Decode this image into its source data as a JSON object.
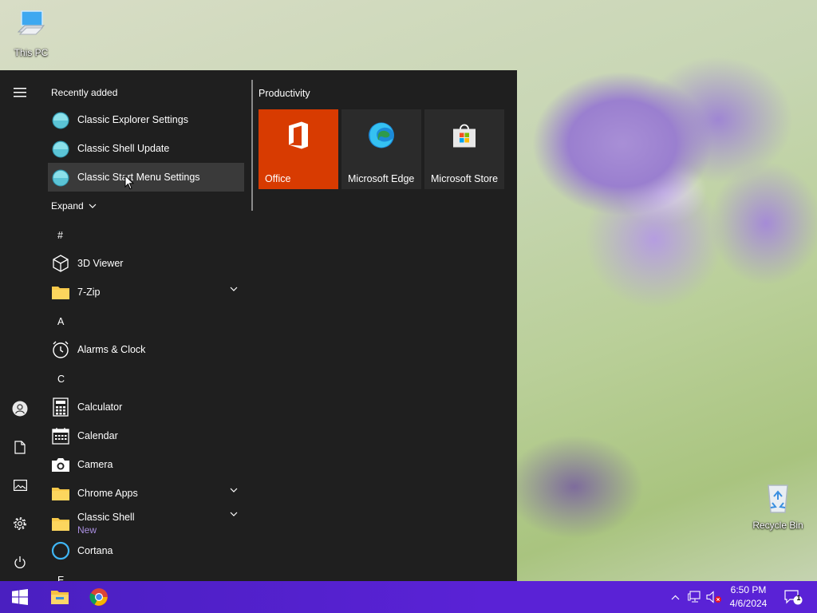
{
  "desktop": {
    "icons": [
      {
        "label": "This PC"
      },
      {
        "label": "Recycle Bin"
      }
    ]
  },
  "start_menu": {
    "recently_added_title": "Recently added",
    "recently_added": [
      {
        "label": "Classic Explorer Settings"
      },
      {
        "label": "Classic Shell Update"
      },
      {
        "label": "Classic Start Menu Settings"
      }
    ],
    "expand_label": "Expand",
    "groups": [
      {
        "letter": "#",
        "apps": [
          {
            "label": "3D Viewer"
          },
          {
            "label": "7-Zip"
          }
        ]
      },
      {
        "letter": "A",
        "apps": [
          {
            "label": "Alarms & Clock"
          }
        ]
      },
      {
        "letter": "C",
        "apps": [
          {
            "label": "Calculator"
          },
          {
            "label": "Calendar"
          },
          {
            "label": "Camera"
          },
          {
            "label": "Chrome Apps"
          },
          {
            "label": "Classic Shell",
            "badge": "New"
          },
          {
            "label": "Cortana"
          }
        ]
      },
      {
        "letter": "E",
        "apps": []
      }
    ],
    "tiles_group_title": "Productivity",
    "tiles": [
      {
        "label": "Office",
        "color": "#d83b01"
      },
      {
        "label": "Microsoft Edge",
        "color": "#2b2b2b"
      },
      {
        "label": "Microsoft Store",
        "color": "#2b2b2b"
      }
    ]
  },
  "taskbar": {
    "clock_time": "6:50 PM",
    "clock_date": "4/6/2024",
    "notification_count": "1",
    "accent": "#4b1fbf"
  }
}
